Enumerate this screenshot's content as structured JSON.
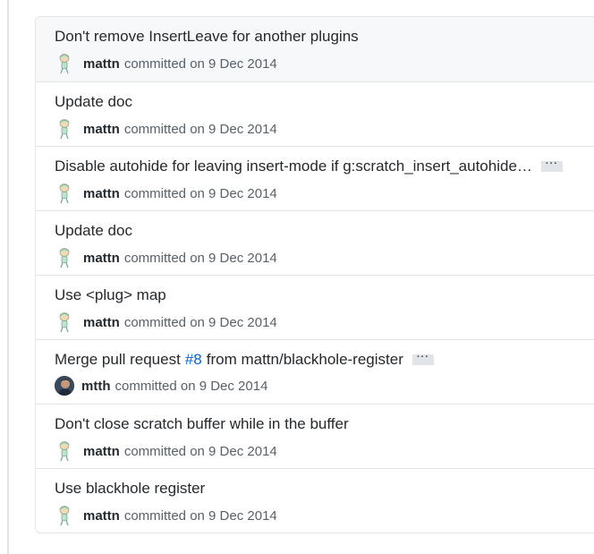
{
  "commits": [
    {
      "title": "Don't remove InsertLeave for another plugins",
      "author": "mattn",
      "committed_text": "committed on 9 Dec 2014"
    },
    {
      "title": "Update doc",
      "author": "mattn",
      "committed_text": "committed on 9 Dec 2014"
    },
    {
      "title": "Disable autohide for leaving insert-mode if g:scratch_insert_autohide…",
      "author": "mattn",
      "committed_text": "committed on 9 Dec 2014",
      "ellipsis": "···"
    },
    {
      "title": "Update doc",
      "author": "mattn",
      "committed_text": "committed on 9 Dec 2014"
    },
    {
      "title": "Use <plug> map",
      "author": "mattn",
      "committed_text": "committed on 9 Dec 2014"
    },
    {
      "title_prefix": "Merge pull request",
      "title_link": "#8",
      "title_suffix": "from mattn/blackhole-register",
      "author": "mtth",
      "committed_text": "committed on 9 Dec 2014",
      "ellipsis": "···"
    },
    {
      "title": "Don't close scratch buffer while in the buffer",
      "author": "mattn",
      "committed_text": "committed on 9 Dec 2014"
    },
    {
      "title": "Use blackhole register",
      "author": "mattn",
      "committed_text": "committed on 9 Dec 2014"
    }
  ]
}
